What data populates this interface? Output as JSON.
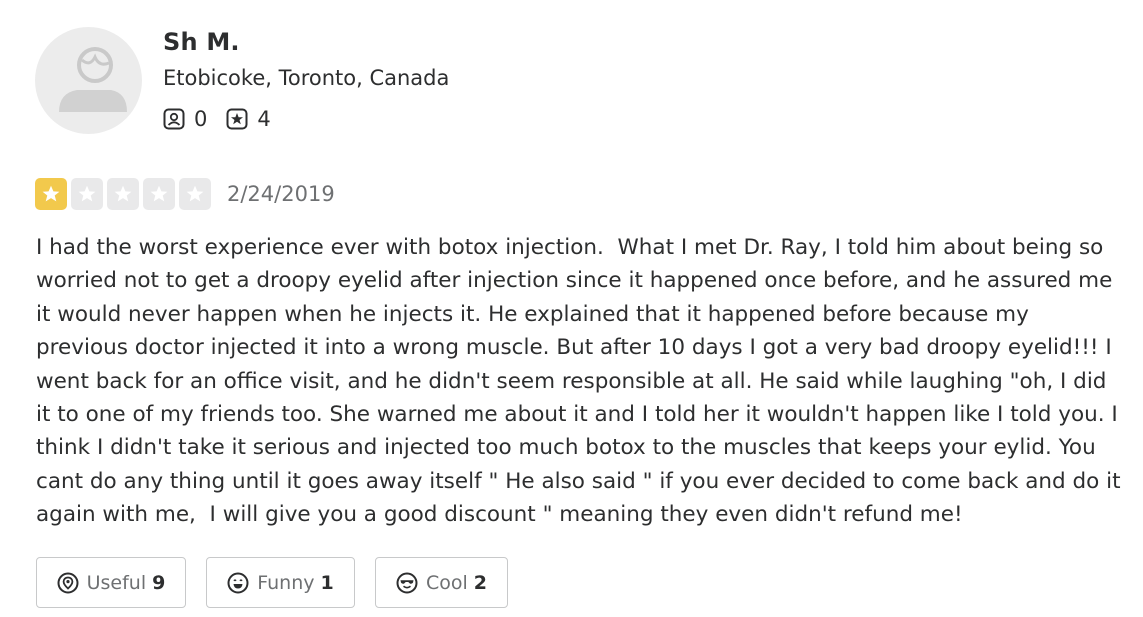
{
  "user": {
    "name": "Sh M.",
    "location": "Etobicoke, Toronto, Canada",
    "friends_count": "0",
    "reviews_count": "4"
  },
  "review": {
    "rating": 1,
    "max_rating": 5,
    "date": "2/24/2019",
    "text": "I had the worst experience ever with botox injection.  What I met Dr. Ray, I told him about being so worried not to get a droopy eyelid after injection since it happened once before, and he assured me it would never happen when he injects it. He explained that it happened before because my previous doctor injected it into a wrong muscle. But after 10 days I got a very bad droopy eyelid!!! I went back for an office visit, and he didn't seem responsible at all. He said while laughing \"oh, I did it to one of my friends too. She warned me about it and I told her it wouldn't happen like I told you. I think I didn't take it serious and injected too much botox to the muscles that keeps your eylid. You cant do any thing until it goes away itself \" He also said \" if you ever decided to come back and do it again with me,  I will give you a good discount \" meaning they even didn't refund me!"
  },
  "reactions": {
    "useful": {
      "label": "Useful",
      "count": "9",
      "icon": "useful-icon"
    },
    "funny": {
      "label": "Funny",
      "count": "1",
      "icon": "funny-icon"
    },
    "cool": {
      "label": "Cool",
      "count": "2",
      "icon": "cool-icon"
    }
  },
  "colors": {
    "star_filled": "#f2c94c",
    "star_empty": "#e9e9ea",
    "text_primary": "#2d2e2f",
    "text_secondary": "#6e7072",
    "button_border": "#c8c9ca",
    "avatar_bg": "#ececec"
  },
  "icons": {
    "avatar": "user-silhouette-icon",
    "friends": "friends-icon",
    "reviews": "review-star-icon",
    "star": "star-icon"
  }
}
